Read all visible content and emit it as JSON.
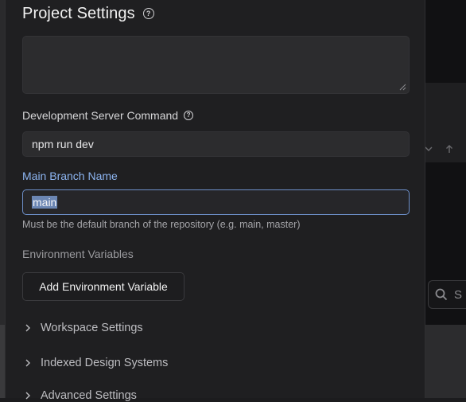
{
  "modal": {
    "title": "Project Settings",
    "dev_server": {
      "label": "Development Server Command",
      "value": "npm run dev"
    },
    "main_branch": {
      "label": "Main Branch Name",
      "value": "main",
      "helper": "Must be the default branch of the repository (e.g. main, master)"
    },
    "env_vars": {
      "label": "Environment Variables",
      "add_button": "Add Environment Variable"
    },
    "sections": [
      {
        "label": "Workspace Settings"
      },
      {
        "label": "Indexed Design Systems"
      },
      {
        "label": "Advanced Settings"
      }
    ]
  },
  "background": {
    "search_placeholder": "S"
  },
  "icons": {
    "help": "question-circle-icon",
    "chevron": "chevron-right-icon",
    "search": "search-icon"
  }
}
